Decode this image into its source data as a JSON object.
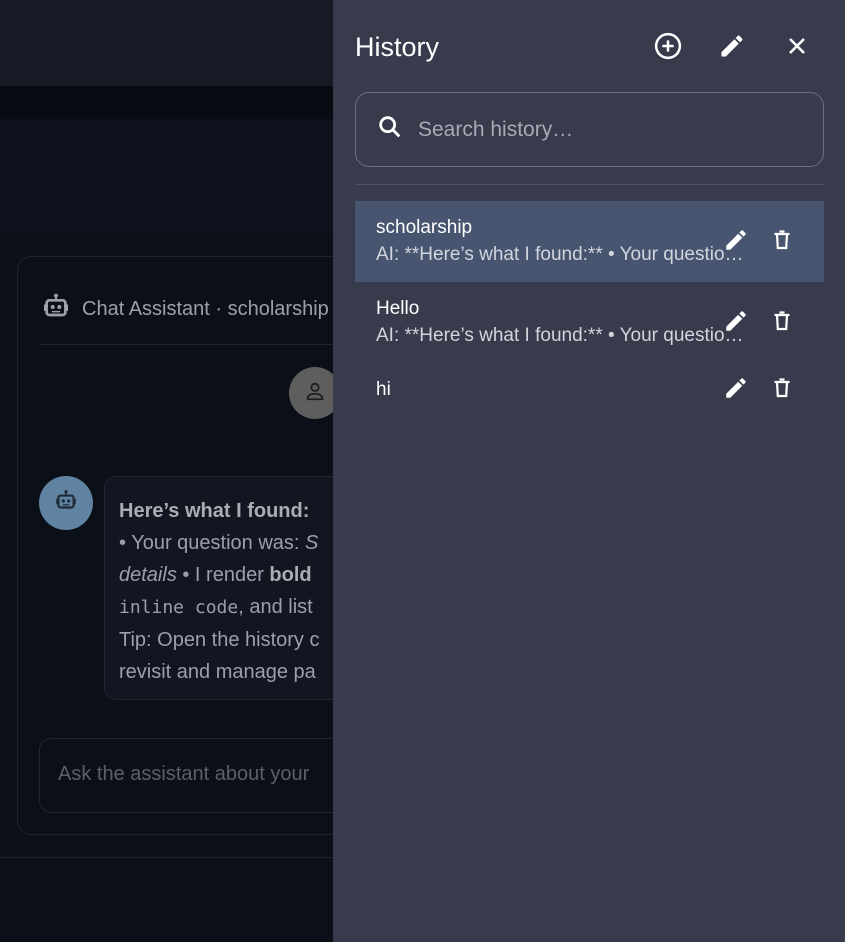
{
  "background": {
    "assistant_title": "Chat Assistant · scholarship",
    "message_heading": "Here’s what I found:",
    "message_line1_a": "• Your question was: ",
    "message_line1_b": "S",
    "message_line2_a": "details",
    "message_line2_b": " • I render ",
    "message_line2_c": "bold",
    "message_line3_a": "inline code",
    "message_line3_b": ", and list",
    "message_line4": "Tip: Open the history c",
    "message_line5": "revisit and manage pa",
    "input_placeholder": "Ask the assistant about your"
  },
  "drawer": {
    "title": "History",
    "search_placeholder": "Search history…",
    "items": [
      {
        "title": "scholarship",
        "preview": "AI: **Here’s what I found:** • Your question was: scholarship",
        "active": true
      },
      {
        "title": "Hello",
        "preview": "AI: **Here’s what I found:** • Your question was: Hello",
        "active": false
      },
      {
        "title": "hi",
        "preview": "",
        "active": false
      }
    ]
  },
  "colors": {
    "drawer_bg": "#373b4b",
    "active_item_bg": "#475570",
    "page_bg": "#0b0f17"
  }
}
